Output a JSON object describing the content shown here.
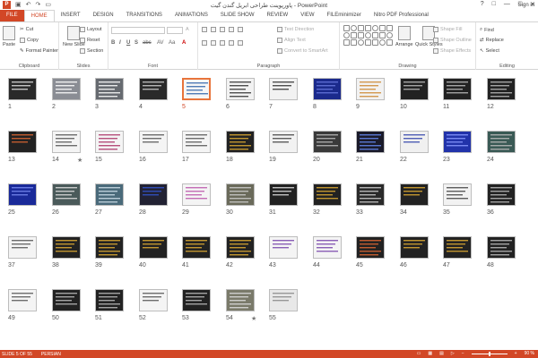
{
  "window": {
    "title": "پاورپوینت طراحی ابریل گندن گیت - PowerPoint",
    "app_logo": "P",
    "quick_access": [
      "save-icon",
      "undo-icon",
      "redo-icon",
      "start-icon"
    ],
    "controls": [
      "?",
      "□",
      "—",
      "□",
      "✕"
    ],
    "sign_in": "Sign in"
  },
  "tabs": [
    {
      "label": "FILE",
      "kind": "file"
    },
    {
      "label": "HOME",
      "kind": "active"
    },
    {
      "label": "INSERT"
    },
    {
      "label": "DESIGN"
    },
    {
      "label": "TRANSITIONS"
    },
    {
      "label": "ANIMATIONS"
    },
    {
      "label": "SLIDE SHOW"
    },
    {
      "label": "REVIEW"
    },
    {
      "label": "VIEW"
    },
    {
      "label": "FILEminimizer"
    },
    {
      "label": "Nitro PDF Professional"
    }
  ],
  "ribbon": {
    "clipboard": {
      "label": "Clipboard",
      "paste": "Paste",
      "cut": "Cut",
      "copy": "Copy",
      "format_painter": "Format Painter"
    },
    "slides": {
      "label": "Slides",
      "new_slide": "New Slide",
      "layout": "Layout",
      "reset": "Reset",
      "section": "Section"
    },
    "font": {
      "label": "Font",
      "buttons": [
        "B",
        "I",
        "U",
        "S",
        "abc",
        "AV",
        "Aa",
        "A"
      ]
    },
    "paragraph": {
      "label": "Paragraph",
      "text_direction": "Text Direction",
      "align_text": "Align Text",
      "convert_smartart": "Convert to SmartArt"
    },
    "drawing": {
      "label": "Drawing",
      "arrange": "Arrange",
      "quick_styles": "Quick Styles",
      "shape_fill": "Shape Fill",
      "shape_outline": "Shape Outline",
      "shape_effects": "Shape Effects"
    },
    "editing": {
      "label": "Editing",
      "find": "Find",
      "replace": "Replace",
      "select": "Select"
    }
  },
  "slides": {
    "selected": 5,
    "items": [
      {
        "n": "1",
        "bg": "#2a2a2a",
        "acc": "#dddddd"
      },
      {
        "n": "2",
        "bg": "#8a8d94",
        "acc": "#ffffff"
      },
      {
        "n": "3",
        "bg": "#666a70",
        "acc": "#ffffff"
      },
      {
        "n": "4",
        "bg": "#2a2a2a",
        "acc": "#cccccc"
      },
      {
        "n": "5",
        "bg": "#f6f6f6",
        "acc": "#3366aa"
      },
      {
        "n": "6",
        "bg": "#f2f2f2",
        "acc": "#333333"
      },
      {
        "n": "7",
        "bg": "#f2f2f2",
        "acc": "#333333"
      },
      {
        "n": "8",
        "bg": "#1b2a8c",
        "acc": "#6677dd"
      },
      {
        "n": "9",
        "bg": "#f2f2f2",
        "acc": "#cc8833"
      },
      {
        "n": "10",
        "bg": "#222222",
        "acc": "#bbbbbb"
      },
      {
        "n": "11",
        "bg": "#222222",
        "acc": "#bbbbbb"
      },
      {
        "n": "12",
        "bg": "#222222",
        "acc": "#bbbbbb"
      },
      {
        "n": "13",
        "bg": "#222222",
        "acc": "#dd6633"
      },
      {
        "n": "14",
        "bg": "#f4f4f4",
        "acc": "#555555",
        "star": true
      },
      {
        "n": "15",
        "bg": "#f4f4f4",
        "acc": "#aa3366"
      },
      {
        "n": "16",
        "bg": "#f4f4f4",
        "acc": "#555555"
      },
      {
        "n": "17",
        "bg": "#f4f4f4",
        "acc": "#555555"
      },
      {
        "n": "18",
        "bg": "#222222",
        "acc": "#ddaa33"
      },
      {
        "n": "19",
        "bg": "#f2f2f2",
        "acc": "#444444"
      },
      {
        "n": "20",
        "bg": "#3a3a3a",
        "acc": "#bbbbbb"
      },
      {
        "n": "21",
        "bg": "#1a1a2a",
        "acc": "#6688ee"
      },
      {
        "n": "22",
        "bg": "#f0f0f0",
        "acc": "#3344aa"
      },
      {
        "n": "23",
        "bg": "#2233aa",
        "acc": "#8899ff"
      },
      {
        "n": "24",
        "bg": "#3a5a55",
        "acc": "#bbbbbb"
      },
      {
        "n": "25",
        "bg": "#1a2a99",
        "acc": "#7788ee"
      },
      {
        "n": "26",
        "bg": "#4a5a5a",
        "acc": "#dddddd"
      },
      {
        "n": "27",
        "bg": "#4a6a7a",
        "acc": "#ccdde8"
      },
      {
        "n": "28",
        "bg": "#222233",
        "acc": "#3355cc"
      },
      {
        "n": "29",
        "bg": "#f4f4f4",
        "acc": "#bb55aa"
      },
      {
        "n": "30",
        "bg": "#6a6a5a",
        "acc": "#cccccc"
      },
      {
        "n": "31",
        "bg": "#222222",
        "acc": "#dddddd"
      },
      {
        "n": "32",
        "bg": "#222222",
        "acc": "#ddaa33"
      },
      {
        "n": "33",
        "bg": "#2a2a2a",
        "acc": "#cccccc"
      },
      {
        "n": "34",
        "bg": "#222222",
        "acc": "#ddaa33"
      },
      {
        "n": "35",
        "bg": "#f2f2f2",
        "acc": "#444444"
      },
      {
        "n": "36",
        "bg": "#222222",
        "acc": "#bbbbbb"
      },
      {
        "n": "37",
        "bg": "#f4f4f4",
        "acc": "#555555"
      },
      {
        "n": "38",
        "bg": "#222222",
        "acc": "#ddaa33"
      },
      {
        "n": "39",
        "bg": "#222222",
        "acc": "#ddaa33"
      },
      {
        "n": "40",
        "bg": "#222222",
        "acc": "#ddaa33"
      },
      {
        "n": "41",
        "bg": "#222222",
        "acc": "#ddaa33"
      },
      {
        "n": "42",
        "bg": "#222222",
        "acc": "#ddaa33"
      },
      {
        "n": "43",
        "bg": "#f4f4f4",
        "acc": "#7744aa"
      },
      {
        "n": "44",
        "bg": "#f4f4f4",
        "acc": "#7744aa"
      },
      {
        "n": "45",
        "bg": "#222222",
        "acc": "#dd6633"
      },
      {
        "n": "46",
        "bg": "#222222",
        "acc": "#ddaa33"
      },
      {
        "n": "47",
        "bg": "#222222",
        "acc": "#ddaa33"
      },
      {
        "n": "48",
        "bg": "#222222",
        "acc": "#bbbbbb"
      },
      {
        "n": "49",
        "bg": "#f4f4f4",
        "acc": "#555555"
      },
      {
        "n": "50",
        "bg": "#222222",
        "acc": "#bbbbbb"
      },
      {
        "n": "51",
        "bg": "#222222",
        "acc": "#bbbbbb"
      },
      {
        "n": "52",
        "bg": "#f4f4f4",
        "acc": "#555555"
      },
      {
        "n": "53",
        "bg": "#222222",
        "acc": "#bbbbbb"
      },
      {
        "n": "54",
        "bg": "#7a7a6a",
        "acc": "#dddddd",
        "star": true
      },
      {
        "n": "55",
        "bg": "#e8e8e8",
        "acc": "#888888"
      }
    ]
  },
  "status": {
    "slide_info": "SLIDE 5 OF 55",
    "language": "PERSIAN",
    "zoom": "90 %"
  },
  "colors": {
    "accent": "#d24726",
    "selection": "#e8743b"
  }
}
